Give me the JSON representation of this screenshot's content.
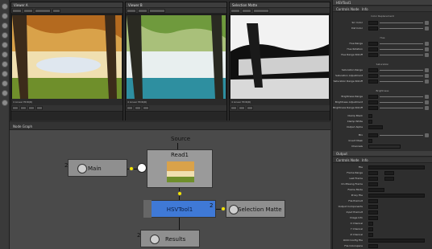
{
  "viewers": [
    {
      "title": "Viewer A",
      "info": "4 Linear HDR(R)"
    },
    {
      "title": "Viewer B",
      "info": "4 Linear HDR(R)"
    },
    {
      "title": "Selection Matte",
      "info": "4 Linear HDR(R)"
    }
  ],
  "node_graph": {
    "tab_label": "Node Graph",
    "nodes": {
      "source": "Source",
      "read": "Read1",
      "main": "Main",
      "hsv": "HSVTool1",
      "selection": "Selection Matte",
      "results": "Results"
    },
    "counts": {
      "main": "2",
      "hsv": "2",
      "results": "2"
    }
  },
  "properties": {
    "header": "HSVTool1",
    "tabs": [
      "Controls",
      "Node",
      "Info"
    ],
    "sections": [
      "Color Replacement",
      "Hue",
      "Saturation",
      "Brightness",
      "Output"
    ],
    "rows": [
      "Src Color",
      "Dst Color",
      "Hue Range",
      "Hue Rotation",
      "Hue Range Rolloff",
      "Saturation Range",
      "Saturation Adjustment",
      "Saturation Range Rolloff",
      "Brightness Range",
      "Brightness Adjustment",
      "Brightness Range Rolloff",
      "Clamp Black",
      "Clamp White",
      "Output Alpha",
      "Mix",
      "Invert Mask",
      "Channels"
    ],
    "output_tabs": [
      "Controls",
      "Node",
      "Info"
    ],
    "output_rows": [
      "File",
      "Frame Range",
      "Last Frame",
      "On Missing Frame",
      "Frame Mode",
      "Proxy File",
      "File Premult",
      "Output Components",
      "Input Premult",
      "Image Info",
      "X Channel",
      "Y Channel",
      "Z Channel",
      "OCIO Config File",
      "File Colorspace"
    ]
  }
}
